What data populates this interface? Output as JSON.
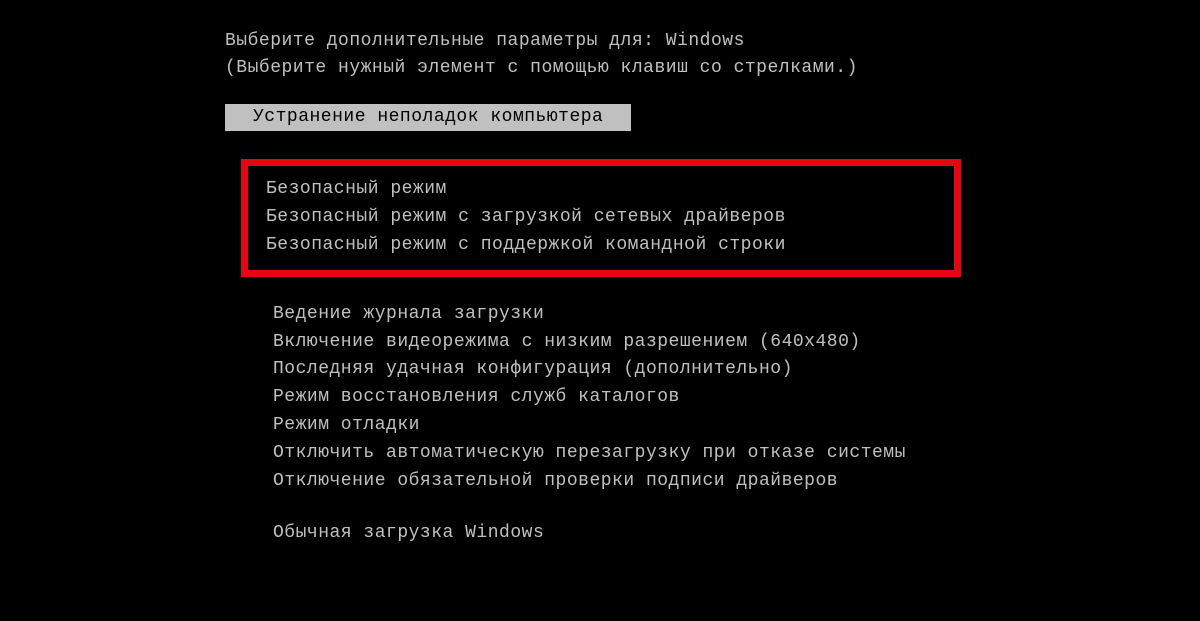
{
  "header": {
    "title": "Выберите дополнительные параметры для: Windows",
    "instruction": "(Выберите нужный элемент с помощью клавиш со стрелками.)"
  },
  "selected": {
    "label": "Устранение неполадок компьютера"
  },
  "safe_mode": {
    "option1": "Безопасный режим",
    "option2": "Безопасный режим с загрузкой сетевых драйверов",
    "option3": "Безопасный режим с поддержкой командной строки"
  },
  "options": {
    "boot_logging": "Ведение журнала загрузки",
    "low_res_video": "Включение видеорежима с низким разрешением (640x480)",
    "last_known_good": "Последняя удачная конфигурация (дополнительно)",
    "directory_restore": "Режим восстановления служб каталогов",
    "debug_mode": "Режим отладки",
    "disable_auto_restart": "Отключить автоматическую перезагрузку при отказе системы",
    "disable_driver_sig": "Отключение обязательной проверки подписи драйверов"
  },
  "normal": {
    "label": "Обычная загрузка Windows"
  }
}
